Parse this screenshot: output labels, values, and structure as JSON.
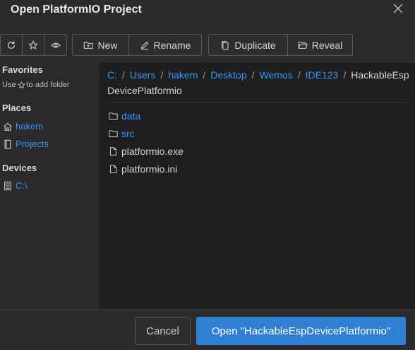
{
  "dialog": {
    "title": "Open PlatformIO Project",
    "close_icon": "close-icon"
  },
  "toolbar": {
    "new_label": "New",
    "rename_label": "Rename",
    "duplicate_label": "Duplicate",
    "reveal_label": "Reveal"
  },
  "sidebar": {
    "favorites_heading": "Favorites",
    "favorites_hint_prefix": "Use",
    "favorites_hint_suffix": "to add folder",
    "places_heading": "Places",
    "places": [
      {
        "label": "hakem",
        "icon": "home-icon"
      },
      {
        "label": "Projects",
        "icon": "book-icon"
      }
    ],
    "devices_heading": "Devices",
    "devices": [
      {
        "label": "C:\\",
        "icon": "drive-icon"
      }
    ]
  },
  "breadcrumb": {
    "parts": [
      "C:",
      "Users",
      "hakem",
      "Desktop",
      "Wemos",
      "IDE123"
    ],
    "current": "HackableEspDevicePlatformio",
    "separator": "/"
  },
  "files": [
    {
      "name": "data",
      "type": "folder"
    },
    {
      "name": "src",
      "type": "folder"
    },
    {
      "name": "platformio.exe",
      "type": "file"
    },
    {
      "name": "platformio.ini",
      "type": "file"
    }
  ],
  "footer": {
    "cancel_label": "Cancel",
    "open_label": "Open \"HackableEspDevicePlatformio\""
  },
  "colors": {
    "accent": "#2f80d4",
    "link": "#3794ff",
    "background": "#1e1e1e",
    "panel": "#2b2b2b"
  }
}
